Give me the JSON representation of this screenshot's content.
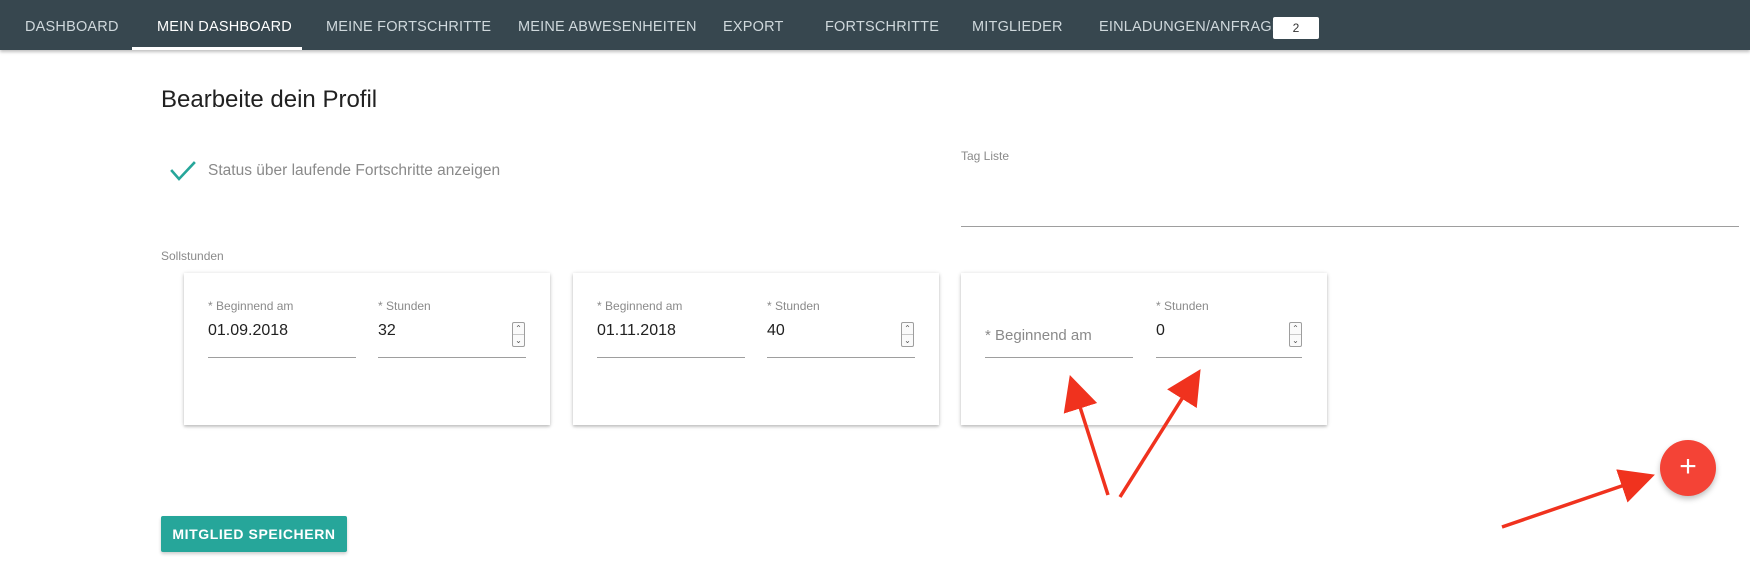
{
  "nav": {
    "items": [
      {
        "label": "DASHBOARD"
      },
      {
        "label": "MEIN DASHBOARD"
      },
      {
        "label": "MEINE FORTSCHRITTE"
      },
      {
        "label": "MEINE ABWESENHEITEN"
      },
      {
        "label": "EXPORT"
      },
      {
        "label": "FORTSCHRITTE"
      },
      {
        "label": "MITGLIEDER"
      },
      {
        "label": "EINLADUNGEN/ANFRAGEN"
      }
    ],
    "active_index": 1,
    "badge": "2"
  },
  "profile": {
    "title": "Bearbeite dein Profil",
    "status_checkbox": {
      "label": "Status über laufende Fortschritte anzeigen",
      "checked": true
    },
    "tag_list_label": "Tag Liste",
    "sollstunden_label": "Sollstunden"
  },
  "cards": [
    {
      "begin_label": "Beginnend am",
      "begin_value": "01.09.2018",
      "hours_label": "Stunden",
      "hours_value": "32"
    },
    {
      "begin_label": "Beginnend am",
      "begin_value": "01.11.2018",
      "hours_label": "Stunden",
      "hours_value": "40"
    },
    {
      "begin_label": "",
      "begin_placeholder": "Beginnend am",
      "begin_value": "",
      "hours_label": "Stunden",
      "hours_value": "0"
    }
  ],
  "required_mark": "*",
  "fab": {
    "icon": "plus-icon",
    "symbol": "+"
  },
  "save_button": {
    "label": "MITGLIED SPEICHERN"
  },
  "colors": {
    "nav_bg": "#37474f",
    "accent": "#26a69a",
    "fab": "#f44336",
    "annotation_arrows": "#f0321e"
  }
}
